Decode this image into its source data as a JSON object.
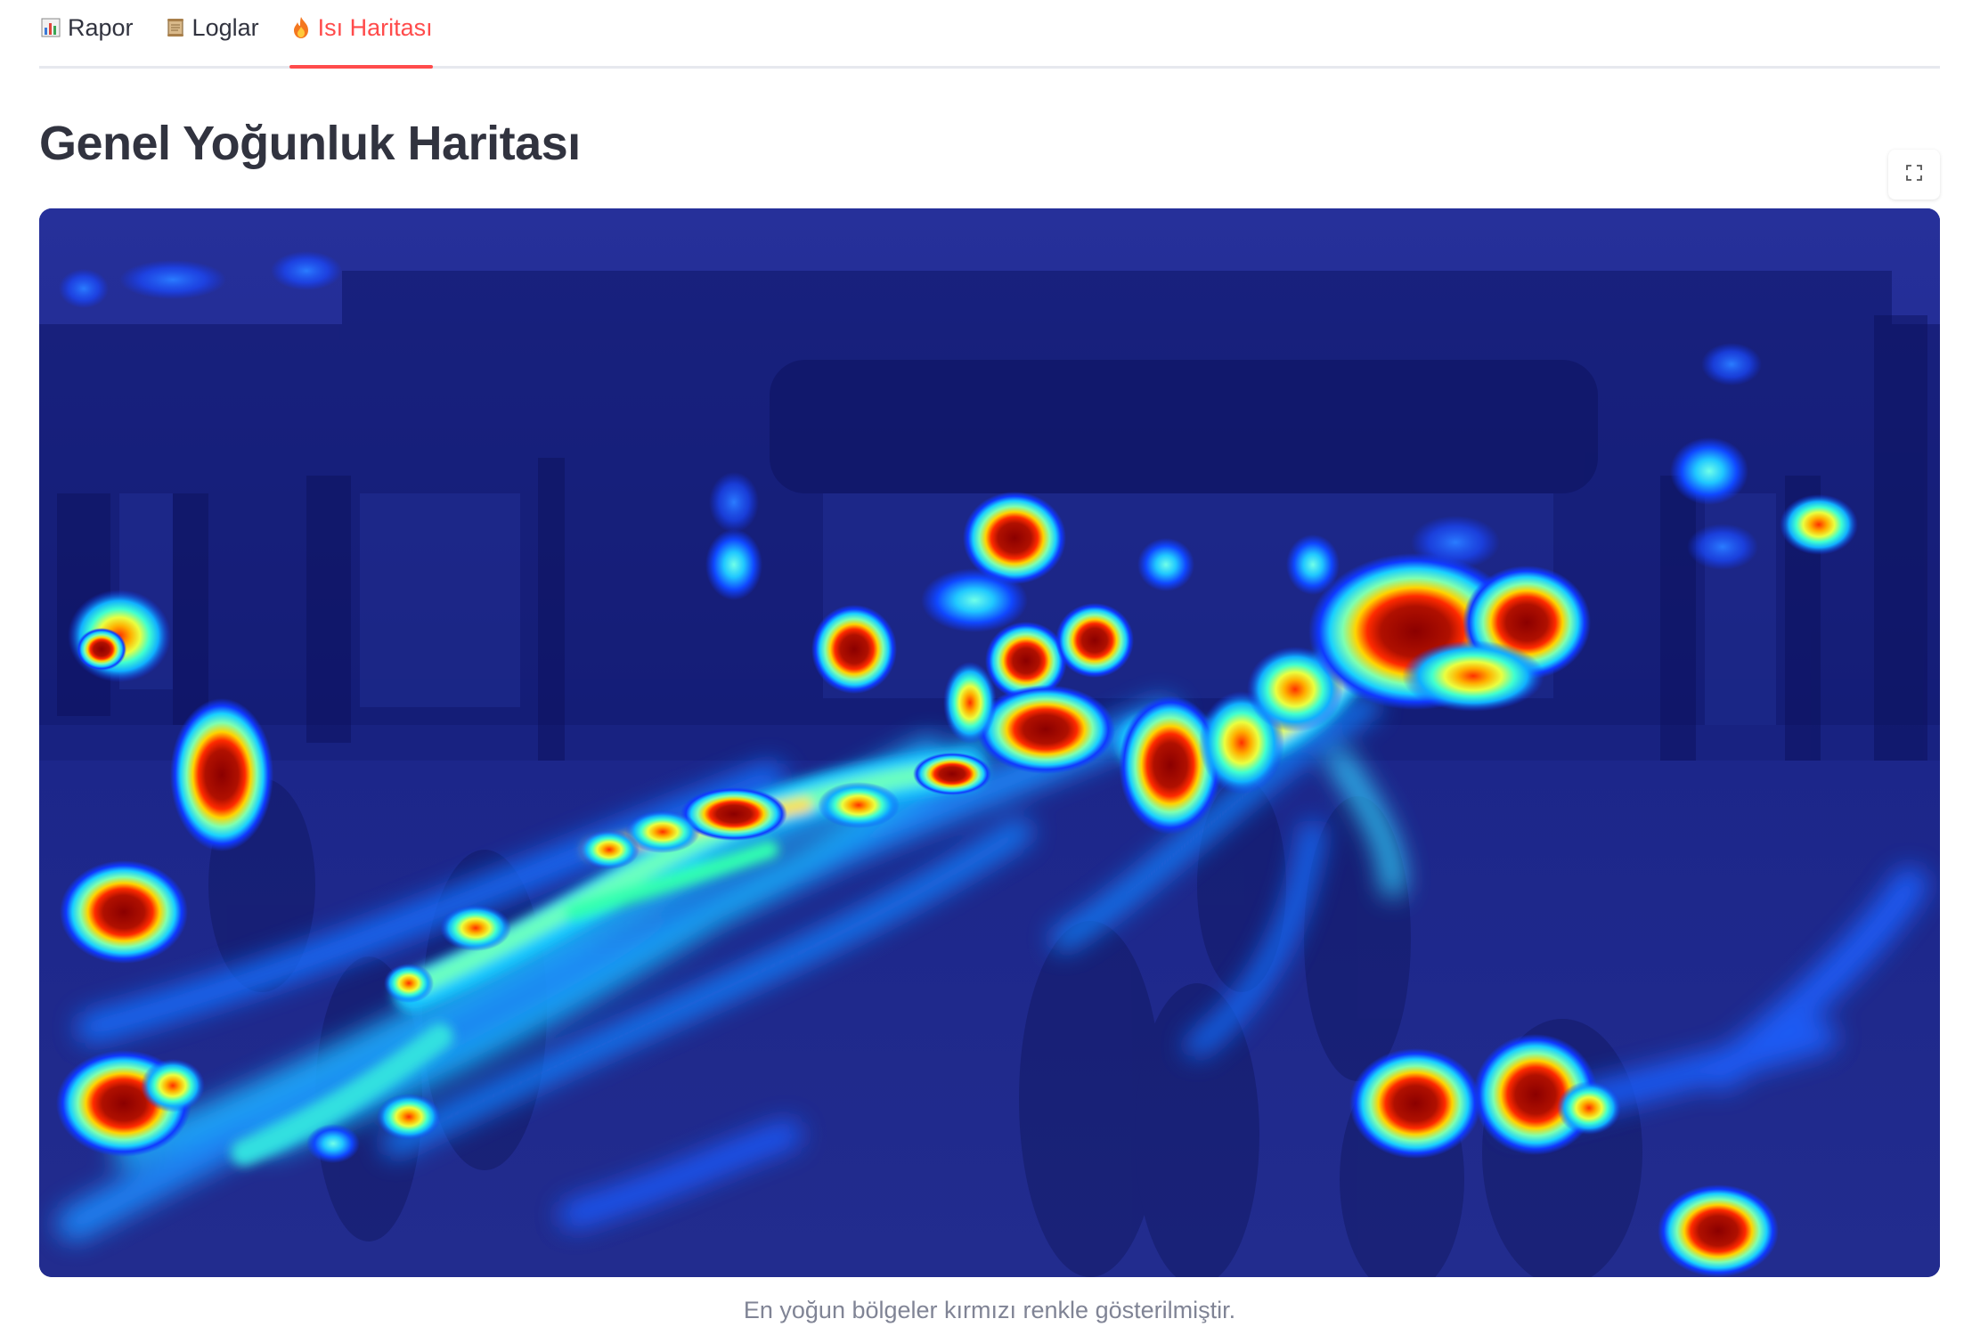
{
  "tabs": [
    {
      "emoji": "📊",
      "icon": "bar-chart-icon",
      "label": "Rapor",
      "active": false
    },
    {
      "emoji": "📜",
      "icon": "scroll-icon",
      "label": "Loglar",
      "active": false
    },
    {
      "emoji": "🔥",
      "icon": "fire-icon",
      "label": "Isı Haritası",
      "active": true
    }
  ],
  "main": {
    "title": "Genel Yoğunluk Haritası",
    "caption": "En yoğun bölgeler kırmızı renkle gösterilmiştir."
  },
  "colors": {
    "accent": "#ff4b4b",
    "text": "#31333f",
    "caption": "#808495",
    "tab_divider": "#e6e8ee",
    "heatmap_base": "#1a2a8a"
  }
}
